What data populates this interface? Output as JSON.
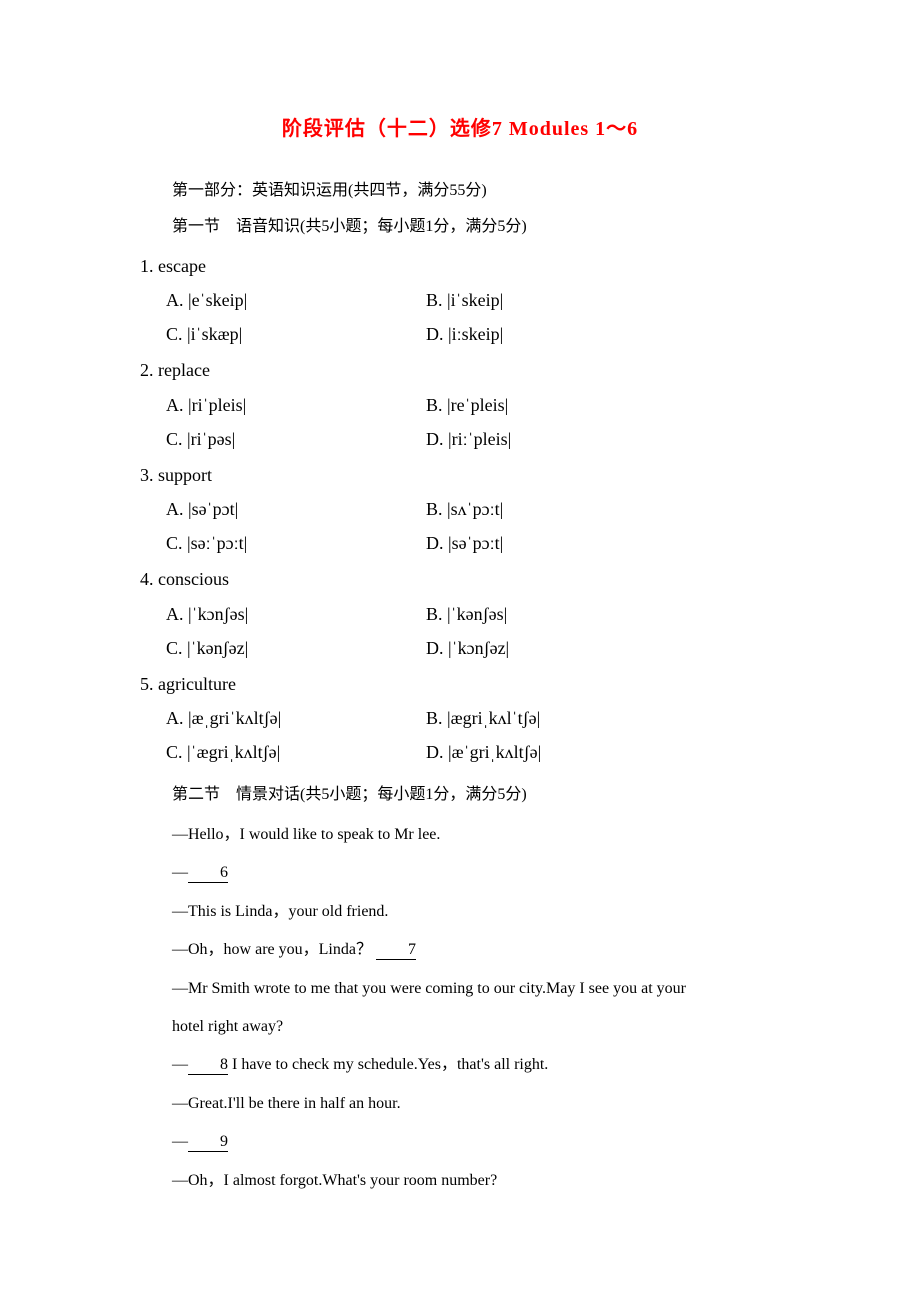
{
  "title": "阶段评估（十二）选修7  Modules  1～6",
  "part1_header": "第一部分：英语知识运用(共四节，满分55分)",
  "section1_header": "第一节　语音知识(共5小题；每小题1分，满分5分)",
  "questions": [
    {
      "num": "1. escape",
      "a": "A. |eˈskeip|",
      "b": "B. |iˈskeip|",
      "c": "C. |iˈskæp|",
      "d": "D. |iːskeip|"
    },
    {
      "num": "2. replace",
      "a": "A. |riˈpleis|",
      "b": "B. |reˈpleis|",
      "c": "C. |riˈpəs|",
      "d": "D. |riːˈpleis|"
    },
    {
      "num": "3. support",
      "a": "A. |səˈpɔt|",
      "b": "B. |sʌˈpɔːt|",
      "c": "C. |səːˈpɔːt|",
      "d": "D. |səˈpɔːt|"
    },
    {
      "num": "4. conscious",
      "a": "A. |ˈkɔnʃəs|",
      "b": "B. |ˈkənʃəs|",
      "c": "C. |ˈkənʃəz|",
      "d": "D. |ˈkɔnʃəz|"
    },
    {
      "num": "5. agriculture",
      "a": "A. |æˌgriˈkʌltʃə|",
      "b": "B. |ægriˌkʌlˈtʃə|",
      "c": "C. |ˈægriˌkʌltʃə|",
      "d": "D. |æˈgriˌkʌltʃə|"
    }
  ],
  "section2_header": "第二节　情景对话(共5小题；每小题1分，满分5分)",
  "dialogue": {
    "l1": "—Hello，I would like to speak to Mr lee.",
    "l2a": "—",
    "b6": "6",
    "l3": "—This is Linda，your old friend.",
    "l4a": "—Oh，how are you，Linda？",
    "b7": "7",
    "l5": "—Mr Smith wrote to me that you were coming to our city.May I see you at your",
    "l6": "hotel right away?",
    "l7a": "—",
    "b8": "8",
    "l7b": "I have to check my schedule.Yes，that's all right.",
    "l8": "—Great.I'll be there in half an hour.",
    "l9a": "—",
    "b9": "9",
    "l10": "—Oh，I almost forgot.What's your room number?"
  }
}
